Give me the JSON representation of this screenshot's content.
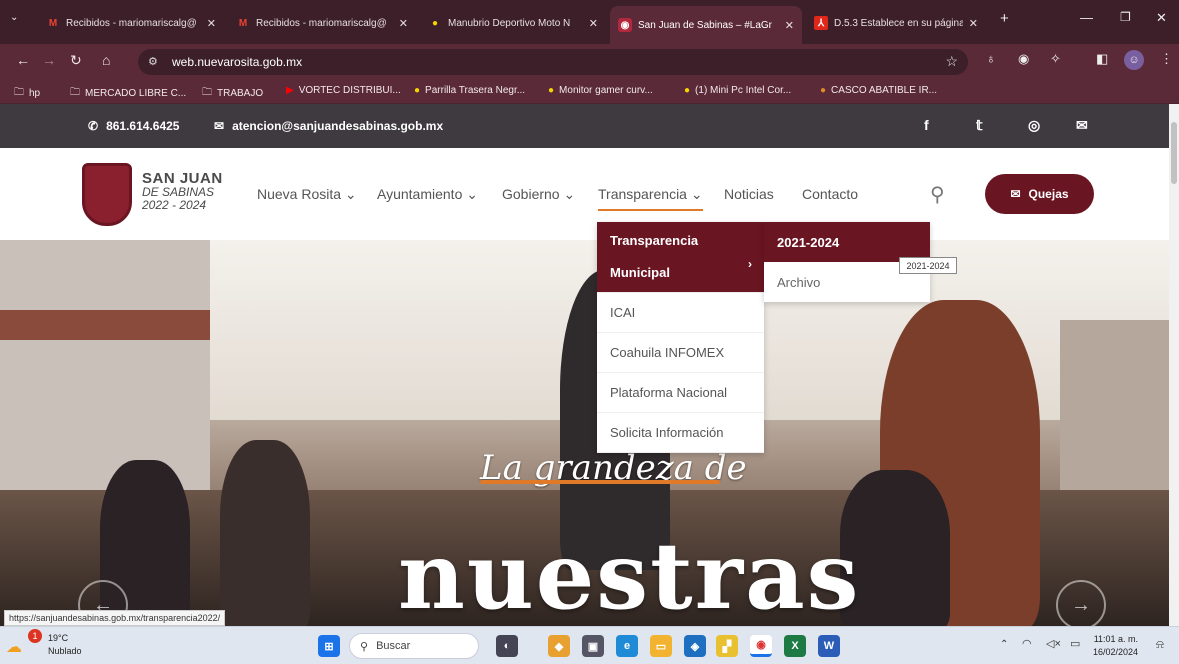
{
  "browser": {
    "tabs": [
      {
        "title": "Recibidos - mariomariscalg@",
        "favicon": "gmail-icon",
        "fav_text": "M"
      },
      {
        "title": "Recibidos - mariomariscalg@",
        "favicon": "gmail-icon",
        "fav_text": "M"
      },
      {
        "title": "Manubrio Deportivo Moto N",
        "favicon": "marketplace-icon",
        "fav_text": "●"
      },
      {
        "title": "San Juan de Sabinas – #LaGr",
        "favicon": "site-icon",
        "fav_text": "◉",
        "active": true
      },
      {
        "title": "D.5.3 Establece en su página",
        "favicon": "pdf-icon",
        "fav_text": "⅄"
      }
    ],
    "new_tab": "+",
    "url": "web.nuevarosita.gob.mx",
    "bookmarks": [
      {
        "label": "hp",
        "icon": "folder-icon",
        "glyph": "🗀"
      },
      {
        "label": "MERCADO LIBRE C...",
        "icon": "folder-icon",
        "glyph": "🗀"
      },
      {
        "label": "TRABAJO",
        "icon": "folder-icon",
        "glyph": "🗀"
      },
      {
        "label": "VORTEC DISTRIBUI...",
        "icon": "youtube-icon",
        "glyph": "▶"
      },
      {
        "label": "Parrilla Trasera Negr...",
        "icon": "marketplace-icon",
        "glyph": "●"
      },
      {
        "label": "Monitor gamer curv...",
        "icon": "marketplace-icon",
        "glyph": "●"
      },
      {
        "label": "(1) Mini Pc Intel Cor...",
        "icon": "marketplace-icon",
        "glyph": "●"
      },
      {
        "label": "CASCO ABATIBLE IR...",
        "icon": "marketplace-icon",
        "glyph": "●"
      }
    ],
    "status_url": "https://sanjuandesabinas.gob.mx/transparencia2022/"
  },
  "site": {
    "phone": "861.614.6425",
    "email": "atencion@sanjuandesabinas.gob.mx",
    "logo": {
      "line1": "SAN JUAN",
      "line2": "DE SABINAS",
      "line3": "2022 - 2024"
    },
    "menu": [
      "Nueva Rosita ⌄",
      "Ayuntamiento ⌄",
      "Gobierno ⌄",
      "Transparencia ⌄",
      "Noticias",
      "Contacto"
    ],
    "quejas": "Quejas",
    "dropdown": [
      {
        "label": "Transparencia Municipal",
        "active": true
      },
      {
        "label": "ICAI"
      },
      {
        "label": "Coahuila INFOMEX"
      },
      {
        "label": "Plataforma Nacional"
      },
      {
        "label": "Solicita Información"
      }
    ],
    "submenu": [
      {
        "label": "2021-2024",
        "active": true
      },
      {
        "label": "Archivo"
      }
    ],
    "tooltip": "2021-2024",
    "hero_line1": "La grandeza de",
    "hero_line2": "nuestras"
  },
  "taskbar": {
    "temp": "19°C",
    "weather": "Nublado",
    "search": "Buscar",
    "time": "11:01 a. m.",
    "date": "16/02/2024",
    "notif_badge": "1"
  },
  "colors": {
    "brand": "#6a1522",
    "accent": "#e07a28",
    "topbar": "#3f3a40",
    "tab_strip": "#3c1f28"
  }
}
